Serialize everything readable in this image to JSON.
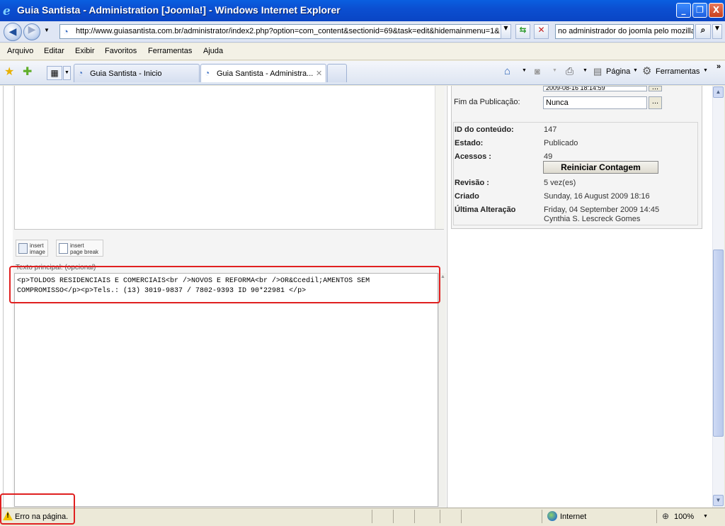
{
  "window": {
    "title": "Guia Santista - Administration [Joomla!] - Windows Internet Explorer",
    "controls": {
      "minimize": "_",
      "maximize": "❐",
      "close": "X"
    }
  },
  "address_bar": {
    "url": "http://www.guiasantista.com.br/administrator/index2.php?option=com_content&sectionid=69&task=edit&hidemainmenu=1&",
    "search_value": "no administrador do joomla pelo mozilla"
  },
  "menu": [
    "Arquivo",
    "Editar",
    "Exibir",
    "Favoritos",
    "Ferramentas",
    "Ajuda"
  ],
  "tabs": [
    {
      "label": "Guia Santista - Inicio"
    },
    {
      "label": "Guia Santista - Administra..."
    }
  ],
  "toolbar": {
    "page_label": "Página",
    "tools_label": "Ferramentas"
  },
  "editor": {
    "insert_image_label_1": "insert",
    "insert_image_label_2": "image",
    "insert_break_label_1": "insert",
    "insert_break_label_2": "page break",
    "main_text_label": "Texto principal: (opcional)",
    "main_text_content": "<p>TOLDOS RESIDENCIAIS E COMERCIAIS<br />NOVOS E REFORMA<br />OR&Ccedil;AMENTOS SEM\nCOMPROMISSO</p><p>Tels.: (13) 3019-9837 / 7802-9393 ID 90*22981 </p>"
  },
  "publishing": {
    "start_value": "2009-08-16 18:14:59",
    "end_label": "Fim da Publicação:",
    "end_value": "Nunca",
    "dots": "..."
  },
  "info": {
    "id_label": "ID do conteúdo:",
    "id_value": "147",
    "state_label": "Estado:",
    "state_value": "Publicado",
    "hits_label": "Acessos :",
    "hits_value": "49",
    "reset_label": "Reiniciar Contagem",
    "revision_label": "Revisão :",
    "revision_value": "5 vez(es)",
    "created_label": "Criado",
    "created_value": "Sunday, 16 August 2009 18:16",
    "modified_label": "Última Alteração",
    "modified_value": "Friday, 04 September 2009 14:45",
    "modified_by": "Cynthia S. Lescreck Gomes"
  },
  "status": {
    "message": "Erro na página.",
    "zone": "Internet",
    "zoom": "100%"
  },
  "colors": {
    "highlight": "#e02020",
    "titlebar": "#0b4fd1"
  }
}
